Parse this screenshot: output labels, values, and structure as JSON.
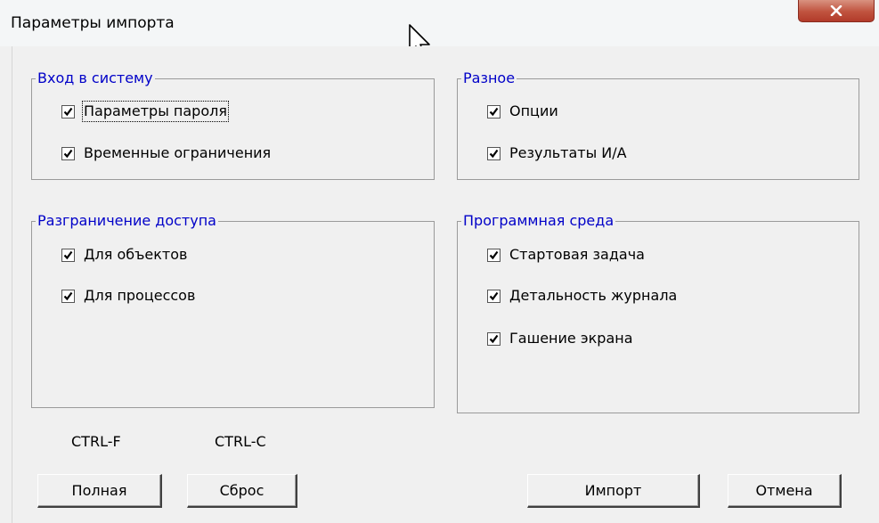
{
  "window": {
    "title": "Параметры импорта",
    "close_icon": "close-icon"
  },
  "groups": {
    "login": {
      "title": "Вход в систему",
      "items": [
        {
          "label": "Параметры пароля",
          "checked": true
        },
        {
          "label": "Временные ограничения",
          "checked": true
        }
      ]
    },
    "misc": {
      "title": "Разное",
      "items": [
        {
          "label": "Опции",
          "checked": true
        },
        {
          "label": "Результаты И/А",
          "checked": true
        }
      ]
    },
    "access": {
      "title": "Разграничение доступа",
      "items": [
        {
          "label": "Для объектов",
          "checked": true
        },
        {
          "label": "Для процессов",
          "checked": true
        }
      ]
    },
    "environment": {
      "title": "Программная среда",
      "items": [
        {
          "label": "Стартовая задача",
          "checked": true
        },
        {
          "label": "Детальность журнала",
          "checked": true
        },
        {
          "label": "Гашение экрана",
          "checked": true
        }
      ]
    }
  },
  "shortcuts": {
    "full": "CTRL-F",
    "reset": "CTRL-C"
  },
  "buttons": {
    "full": "Полная",
    "reset": "Сброс",
    "import": "Импорт",
    "cancel": "Отмена"
  },
  "colors": {
    "group_title": "#0000c8",
    "close_button": "#c0533f"
  }
}
